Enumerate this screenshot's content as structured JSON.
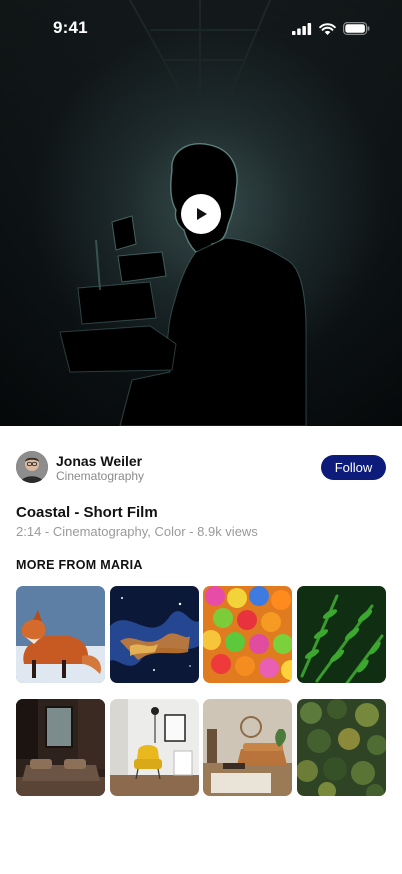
{
  "status_bar": {
    "time": "9:41",
    "icons": [
      "cellular-signal-icon",
      "wifi-icon",
      "battery-icon"
    ]
  },
  "video": {
    "play_icon": "play-icon",
    "title": "Coastal - Short Film",
    "meta": "2:14 - Cinematography, Color - 8.9k views"
  },
  "author": {
    "name": "Jonas Weiler",
    "role": "Cinematography",
    "follow_label": "Follow"
  },
  "more": {
    "title": "MORE FROM MARIA",
    "items": [
      "red-fox-thumbnail",
      "nebula-thumbnail",
      "colorful-balls-thumbnail",
      "fern-leaves-thumbnail",
      "dark-living-room-thumbnail",
      "yellow-chair-room-thumbnail",
      "cozy-living-room-thumbnail",
      "aerial-forest-thumbnail"
    ]
  },
  "colors": {
    "accent": "#0d1b7a",
    "secondary_text": "#9a9a9a"
  }
}
